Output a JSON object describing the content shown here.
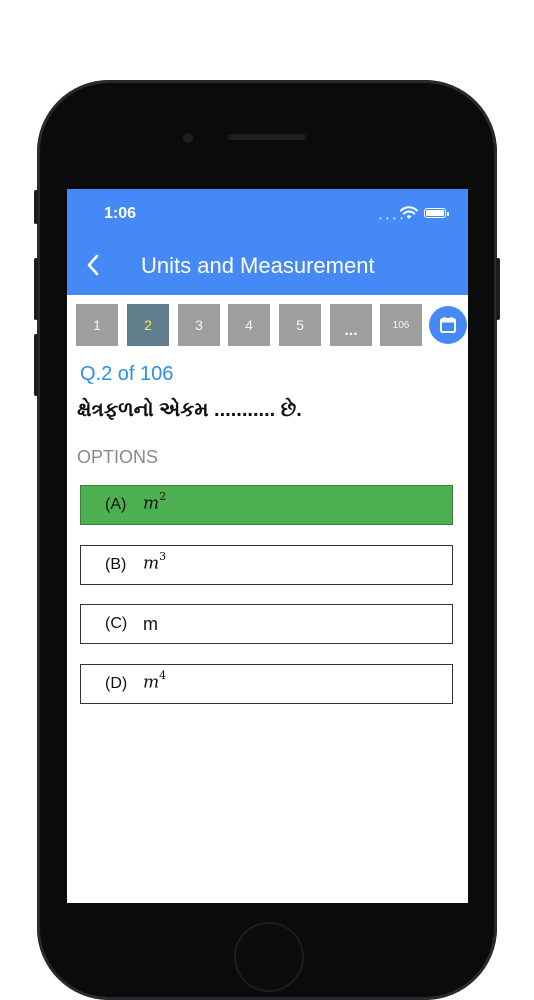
{
  "status_bar": {
    "time": "1:06"
  },
  "header": {
    "title": "Units and Measurement"
  },
  "pager": {
    "pages": [
      "1",
      "2",
      "3",
      "4",
      "5",
      "...",
      "106"
    ],
    "active": "2"
  },
  "question": {
    "number_label": "Q.2 of 106",
    "text": "ક્ષેત્રફળનો એકમ ........... છે."
  },
  "options_label": "OPTIONS",
  "options": [
    {
      "letter": "(A)",
      "base": "m",
      "exp": "2",
      "state": "correct"
    },
    {
      "letter": "(B)",
      "base": "m",
      "exp": "3",
      "state": "default"
    },
    {
      "letter": "(C)",
      "base": "m",
      "exp": "",
      "state": "default"
    },
    {
      "letter": "(D)",
      "base": "m",
      "exp": "4",
      "state": "default"
    }
  ],
  "colors": {
    "app_bar": "#4489f6",
    "page_button": "#9e9e9e",
    "page_button_active": "#607d8b",
    "correct_option": "#4caf50",
    "question_number": "#2b8fe6"
  },
  "icons": {
    "back": "chevron-left-icon",
    "calendar": "calendar-icon",
    "wifi": "wifi-icon",
    "battery": "battery-icon"
  }
}
